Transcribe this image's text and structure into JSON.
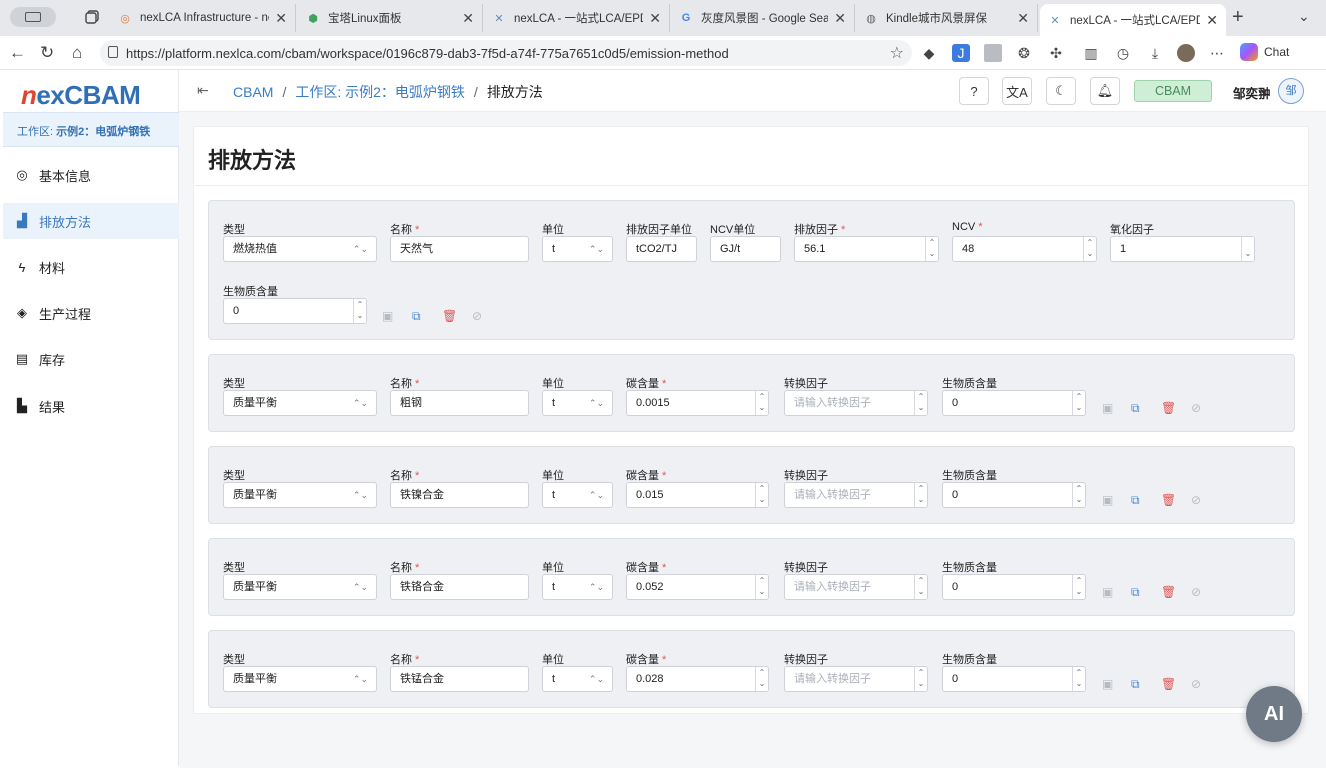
{
  "browser": {
    "tabs": [
      {
        "title": "nexLCA Infrastructure - nex",
        "icon": "nexlca-infra-icon"
      },
      {
        "title": "宝塔Linux面板",
        "icon": "baota-icon"
      },
      {
        "title": "nexLCA - 一站式LCA/EPD平",
        "icon": "nexlca-icon"
      },
      {
        "title": "灰度风景图 - Google Search",
        "icon": "google-icon"
      },
      {
        "title": "Kindle城市风景屏保",
        "icon": "globe-icon"
      },
      {
        "title": "nexLCA - 一站式LCA/EPD平",
        "icon": "nexlca-icon",
        "active": true
      }
    ],
    "url": "https://platform.nexlca.com/cbam/workspace/0196c879-dab3-7f5d-a74f-775a7651c0d5/emission-method",
    "chat_label": "Chat"
  },
  "app": {
    "brand_prefix": "n",
    "brand_rest": "exCBAM",
    "workspace_prefix": "工作区:",
    "workspace_name": "示例2：电弧炉钢铁",
    "sidebar": [
      {
        "label": "基本信息",
        "icon": "target-icon"
      },
      {
        "label": "排放方法",
        "icon": "chart-icon",
        "active": true
      },
      {
        "label": "材料",
        "icon": "bolt-icon"
      },
      {
        "label": "生产过程",
        "icon": "layers-icon"
      },
      {
        "label": "库存",
        "icon": "book-icon"
      },
      {
        "label": "结果",
        "icon": "bar-chart-icon"
      }
    ],
    "breadcrumb": [
      "CBAM",
      "工作区: 示例2：电弧炉钢铁",
      "排放方法"
    ],
    "header": {
      "help": "?",
      "badge": "CBAM",
      "user_name": "邹奕翀",
      "avatar_text": "邹"
    },
    "page_title": "排放方法",
    "ai_button": "AI"
  },
  "first_row": {
    "labels": {
      "type": "类型",
      "name": "名称",
      "unit": "单位",
      "ef_unit": "排放因子单位",
      "ncv_unit": "NCV单位",
      "ef": "排放因子",
      "ncv": "NCV",
      "ox": "氧化因子",
      "bio": "生物质含量"
    },
    "type": "燃烧热值",
    "name": "天然气",
    "unit": "t",
    "ef_unit": "tCO2/TJ",
    "ncv_unit": "GJ/t",
    "ef": "56.1",
    "ncv": "48",
    "ox": "1",
    "bio": "0"
  },
  "mass_rows_labels": {
    "type": "类型",
    "name": "名称",
    "unit": "单位",
    "carbon": "碳含量",
    "conv": "转换因子",
    "bio": "生物质含量",
    "conv_placeholder": "请输入转换因子"
  },
  "mass_rows": [
    {
      "type": "质量平衡",
      "name": "粗钢",
      "unit": "t",
      "carbon": "0.0015",
      "bio": "0"
    },
    {
      "type": "质量平衡",
      "name": "铁镍合金",
      "unit": "t",
      "carbon": "0.015",
      "bio": "0"
    },
    {
      "type": "质量平衡",
      "name": "铁铬合金",
      "unit": "t",
      "carbon": "0.052",
      "bio": "0"
    },
    {
      "type": "质量平衡",
      "name": "铁锰合金",
      "unit": "t",
      "carbon": "0.028",
      "bio": "0"
    }
  ]
}
